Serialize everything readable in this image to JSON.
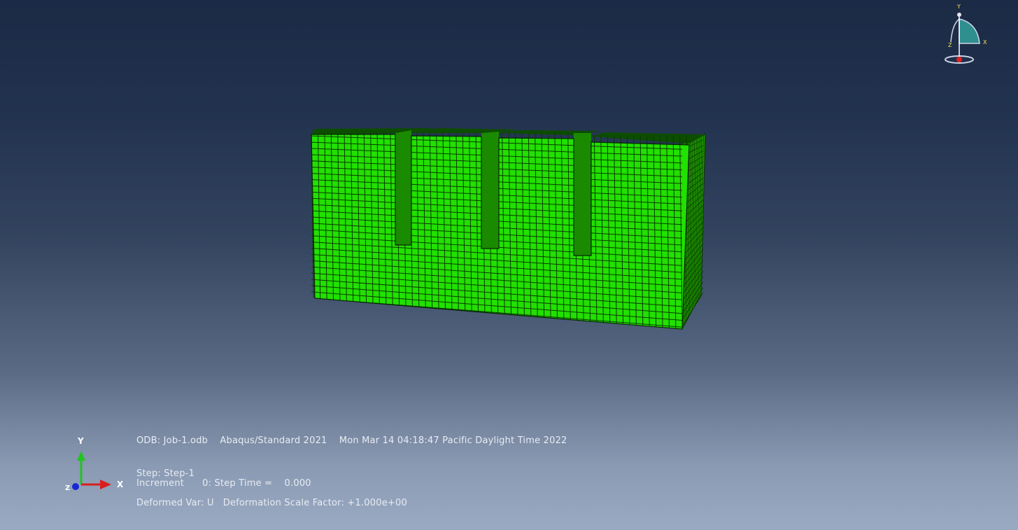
{
  "viewport": {
    "model_color": "#22e000",
    "mesh_color": "#0a3a00"
  },
  "info": {
    "odb_line": "ODB: Job-1.odb    Abaqus/Standard 2021    Mon Mar 14 04:18:47 Pacific Daylight Time 2022",
    "step_line": "Step: Step-1",
    "increment_line": "Increment      0: Step Time =    0.000",
    "deformed_line": "Deformed Var: U   Deformation Scale Factor: +1.000e+00"
  },
  "triad": {
    "y_label": "Y",
    "x_label": "X",
    "z_label": "Z"
  },
  "view_cube": {
    "y_label": "Y",
    "x_label": "X",
    "z_label": "Z"
  }
}
